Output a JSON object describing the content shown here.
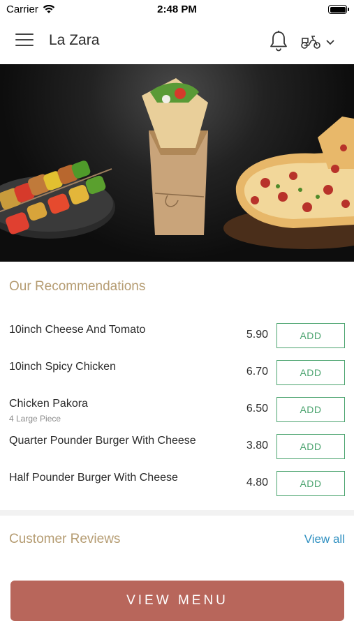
{
  "status_bar": {
    "carrier": "Carrier",
    "time": "2:48 PM"
  },
  "header": {
    "title": "La Zara",
    "menu_icon": "hamburger-menu-icon",
    "notification_icon": "bell-icon",
    "delivery_icon": "scooter-icon",
    "dropdown_icon": "chevron-down-icon"
  },
  "hero": {
    "description_icon": "food-banner-image"
  },
  "recommendations": {
    "title": "Our Recommendations",
    "items": [
      {
        "name": "10inch Cheese And Tomato",
        "subtitle": "",
        "price": "5.90",
        "button": "ADD"
      },
      {
        "name": "10inch Spicy Chicken",
        "subtitle": "",
        "price": "6.70",
        "button": "ADD"
      },
      {
        "name": "Chicken Pakora",
        "subtitle": "4 Large Piece",
        "price": "6.50",
        "button": "ADD"
      },
      {
        "name": "Quarter Pounder Burger With Cheese",
        "subtitle": "",
        "price": "3.80",
        "button": "ADD"
      },
      {
        "name": "Half Pounder Burger With Cheese",
        "subtitle": "",
        "price": "4.80",
        "button": "ADD"
      }
    ]
  },
  "reviews": {
    "title": "Customer Reviews",
    "view_all": "View all"
  },
  "footer": {
    "view_menu": "VIEW MENU"
  },
  "colors": {
    "accent_gold": "#b59c72",
    "add_green": "#4aa36e",
    "link_blue": "#2e8fc0",
    "menu_button": "#b8665b"
  }
}
